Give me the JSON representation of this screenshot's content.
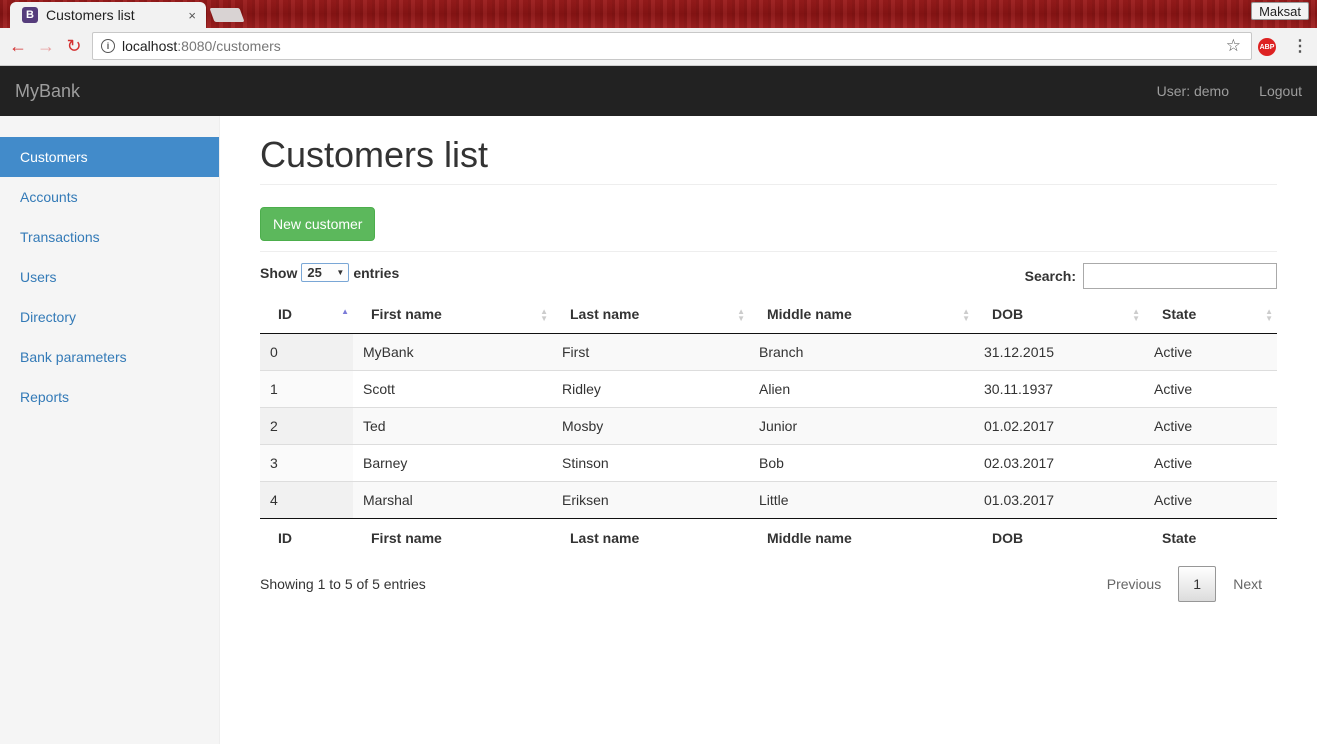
{
  "browser": {
    "tab_title": "Customers list",
    "tab_favicon_letter": "B",
    "tab_close": "×",
    "profile_name": "Maksat",
    "url_host": "localhost",
    "url_path": ":8080/customers",
    "abp_label": "ABP"
  },
  "navbar": {
    "brand": "MyBank",
    "user_label": "User: demo",
    "logout_label": "Logout"
  },
  "sidebar": {
    "items": [
      {
        "label": "Customers",
        "active": true
      },
      {
        "label": "Accounts"
      },
      {
        "label": "Transactions"
      },
      {
        "label": "Users"
      },
      {
        "label": "Directory"
      },
      {
        "label": "Bank parameters"
      },
      {
        "label": "Reports"
      }
    ]
  },
  "main": {
    "title": "Customers list",
    "new_button": "New customer"
  },
  "datatable": {
    "show_label": "Show",
    "length_value": "25",
    "entries_label": "entries",
    "search_label": "Search:",
    "search_value": "",
    "columns": [
      "ID",
      "First name",
      "Last name",
      "Middle name",
      "DOB",
      "State"
    ],
    "sort_column": "ID",
    "sort_direction": "asc",
    "rows": [
      [
        "0",
        "MyBank",
        "First",
        "Branch",
        "31.12.2015",
        "Active"
      ],
      [
        "1",
        "Scott",
        "Ridley",
        "Alien",
        "30.11.1937",
        "Active"
      ],
      [
        "2",
        "Ted",
        "Mosby",
        "Junior",
        "01.02.2017",
        "Active"
      ],
      [
        "3",
        "Barney",
        "Stinson",
        "Bob",
        "02.03.2017",
        "Active"
      ],
      [
        "4",
        "Marshal",
        "Eriksen",
        "Little",
        "01.03.2017",
        "Active"
      ]
    ],
    "info": "Showing 1 to 5 of 5 entries",
    "pagination": {
      "previous": "Previous",
      "current": "1",
      "next": "Next"
    }
  },
  "colors": {
    "navbar_bg": "#222222",
    "sidebar_active": "#428bca",
    "link": "#337ab7",
    "success": "#5cb85c"
  }
}
